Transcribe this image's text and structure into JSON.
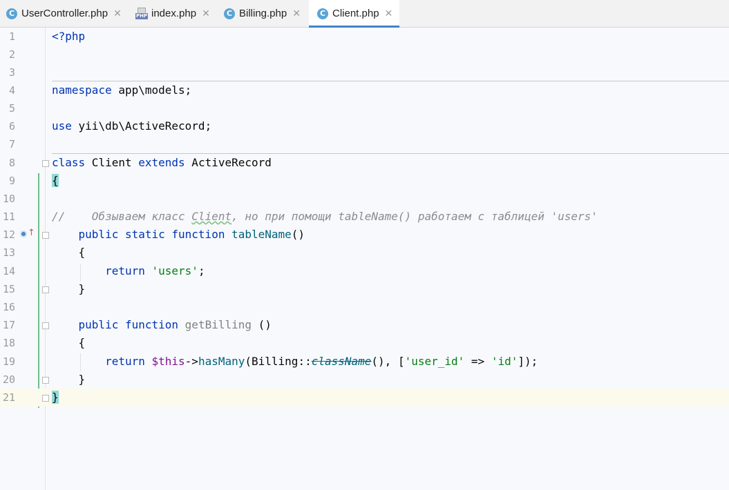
{
  "tabs": [
    {
      "label": "UserController.php",
      "icon": "class-c-icon",
      "active": false
    },
    {
      "label": "index.php",
      "icon": "php-file-icon",
      "icon_text": "PHP",
      "active": false
    },
    {
      "label": "Billing.php",
      "icon": "class-c-icon",
      "active": false
    },
    {
      "label": "Client.php",
      "icon": "class-c-icon",
      "active": true
    }
  ],
  "tab_icon_letter": "C",
  "close_glyph": "✕",
  "colors": {
    "keyword": "#0033b3",
    "string": "#067d17",
    "comment": "#8c8c8c",
    "function": "#00627a",
    "active_tab_underline": "#4083c9",
    "current_line": "#fcfaed",
    "brace_highlight": "#93d9d9"
  },
  "editor": {
    "current_line": 21,
    "line_numbers": [
      "1",
      "2",
      "3",
      "4",
      "5",
      "6",
      "7",
      "8",
      "9",
      "10",
      "11",
      "12",
      "13",
      "14",
      "15",
      "16",
      "17",
      "18",
      "19",
      "20",
      "21"
    ],
    "code": {
      "l1": {
        "php_open": "<?php"
      },
      "l4": {
        "kw": "namespace",
        "rest": " app\\models;"
      },
      "l6": {
        "kw": "use",
        "rest": " yii\\db\\ActiveRecord;"
      },
      "l8": {
        "kw_class": "class",
        "name": " Client ",
        "kw_extends": "extends",
        "parent": " ActiveRecord"
      },
      "l9": {
        "brace": "{"
      },
      "l11": {
        "comment_pre": "//    Обзываем класс ",
        "comment_ref": "Client",
        "comment_post": ", но при помощи tableName() работаем с таблицей 'users'"
      },
      "l12": {
        "indent": "    ",
        "kw": "public static function",
        "sp": " ",
        "fn": "tableName",
        "rest": "()"
      },
      "l13": {
        "text": "    {"
      },
      "l14": {
        "indent": "        ",
        "kw": "return",
        "sp": " ",
        "str": "'users'",
        "rest": ";"
      },
      "l15": {
        "text": "    }"
      },
      "l17": {
        "indent": "    ",
        "kw": "public function",
        "sp": " ",
        "fn": "getBilling",
        "rest": " ()"
      },
      "l18": {
        "text": "    {"
      },
      "l19": {
        "indent": "        ",
        "kw": "return",
        "sp": " ",
        "var": "$this",
        "arrow": "->",
        "fn": "hasMany",
        "p1": "(Billing::",
        "deprecated": "className",
        "p2": "(), [",
        "s1": "'user_id'",
        "op": " => ",
        "s2": "'id'",
        "p3": "]);"
      },
      "l20": {
        "text": "    }"
      },
      "l21": {
        "brace": "}"
      }
    }
  }
}
